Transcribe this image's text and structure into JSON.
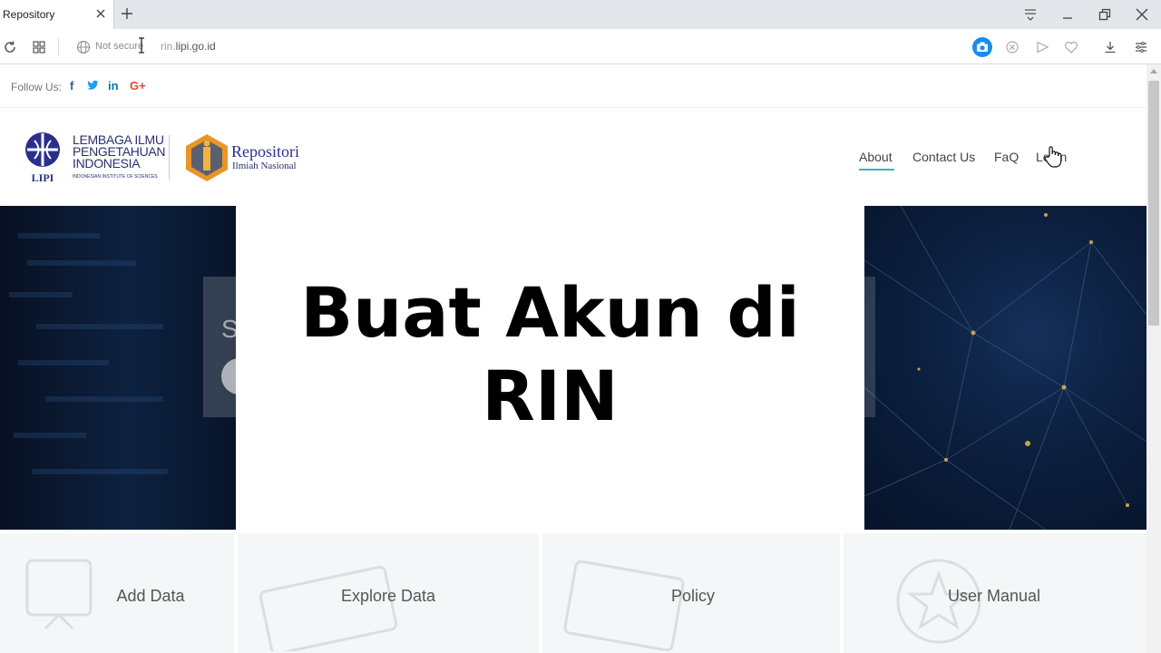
{
  "browser": {
    "tab_title": "Repository",
    "security_label": "Not secure",
    "url_prefix": "rin.",
    "url_domain": "lipi.go.id",
    "accent": "#1a8cf0"
  },
  "topbar": {
    "follow_label": "Follow Us:",
    "social": [
      {
        "glyph": "f",
        "color": "#3b5998",
        "icon": "facebook-icon"
      },
      {
        "glyph": "twitter",
        "color": "#1da1f2",
        "icon": "twitter-icon"
      },
      {
        "glyph": "in",
        "color": "#0077b5",
        "icon": "linkedin-icon"
      },
      {
        "glyph": "G+",
        "color": "#dd4b39",
        "icon": "google-plus-icon"
      }
    ]
  },
  "header": {
    "lipi_line1": "LEMBAGA ILMU",
    "lipi_line2": "PENGETAHUAN",
    "lipi_line3": "INDONESIA",
    "lipi_sub": "INDONESIAN INSTITUTE OF SCIENCES",
    "lipi_mark": "LIPI",
    "rin_title": "Repositori",
    "rin_sub": "Ilmiah Nasional"
  },
  "nav": {
    "about": "About",
    "contact": "Contact Us",
    "faq": "FaQ",
    "login": "Login",
    "active_color": "#3bb6b0"
  },
  "hero": {
    "title_line1": "Buat Akun di",
    "title_line2": "RIN",
    "left_letter": "S"
  },
  "features": {
    "add": "Add Data",
    "explore": "Explore Data",
    "policy": "Policy",
    "manual": "User Manual"
  }
}
